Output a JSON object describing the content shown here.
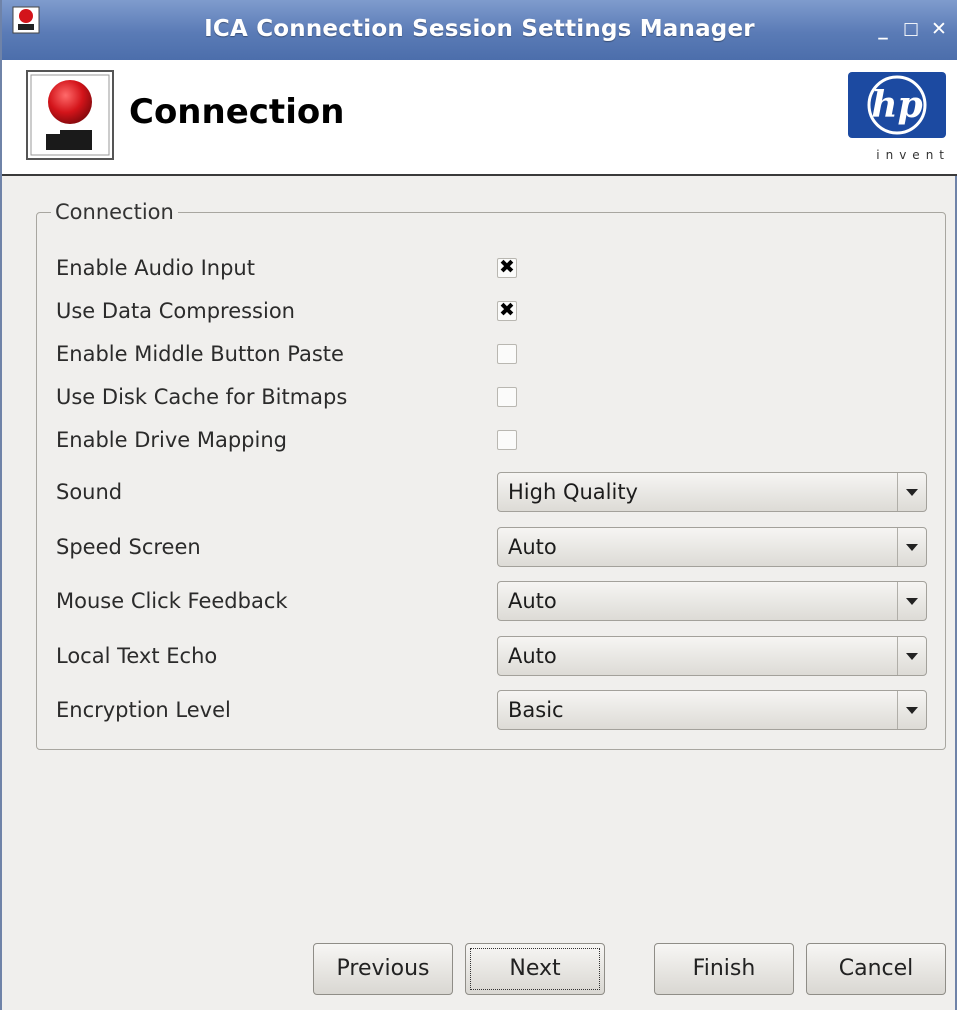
{
  "window": {
    "title": "ICA Connection Session Settings Manager",
    "titlebar_color": "#5a7bb6",
    "controls": {
      "minimize": "_",
      "maximize": "□",
      "close": "✕"
    }
  },
  "header": {
    "title": "Connection",
    "logo": {
      "brand": "hp",
      "tagline": "invent",
      "color": "#1c4aa1"
    }
  },
  "group": {
    "legend": "Connection",
    "checkboxes": [
      {
        "label": "Enable Audio Input",
        "checked": true,
        "mark": "✖"
      },
      {
        "label": "Use Data Compression",
        "checked": true,
        "mark": "✖"
      },
      {
        "label": "Enable Middle Button Paste",
        "checked": false,
        "mark": ""
      },
      {
        "label": "Use Disk Cache for Bitmaps",
        "checked": false,
        "mark": ""
      },
      {
        "label": "Enable Drive Mapping",
        "checked": false,
        "mark": ""
      }
    ],
    "selects": [
      {
        "label": "Sound",
        "value": "High Quality"
      },
      {
        "label": "Speed Screen",
        "value": "Auto"
      },
      {
        "label": "Mouse Click Feedback",
        "value": "Auto"
      },
      {
        "label": "Local Text Echo",
        "value": "Auto"
      },
      {
        "label": "Encryption Level",
        "value": "Basic"
      }
    ]
  },
  "buttons": {
    "previous": "Previous",
    "next": "Next",
    "finish": "Finish",
    "cancel": "Cancel"
  }
}
